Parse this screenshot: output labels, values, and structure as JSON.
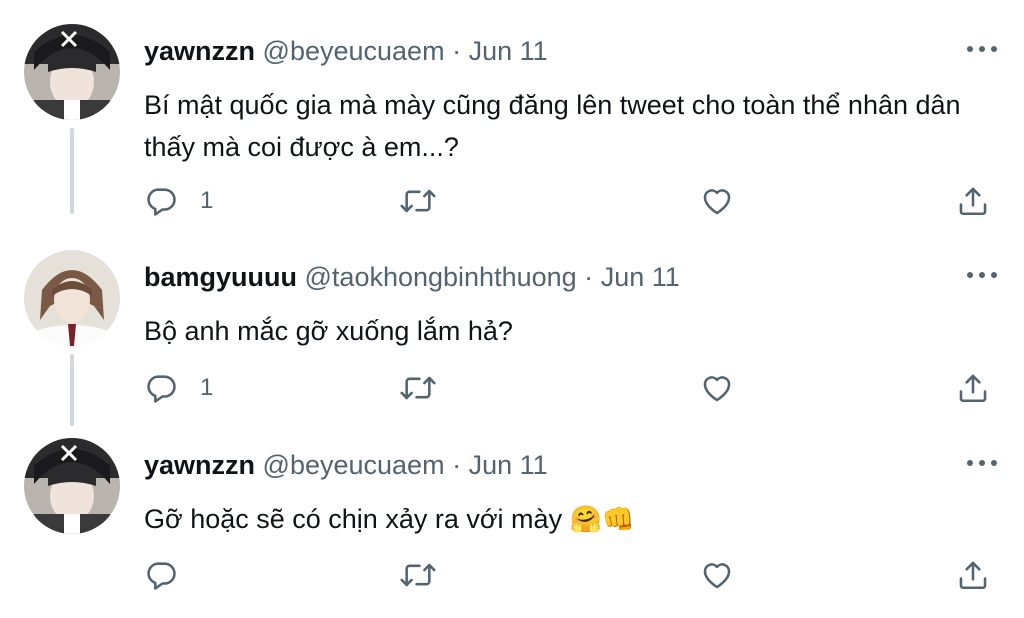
{
  "tweets": [
    {
      "name": "yawnzzn",
      "handle": "@beyeucuaem",
      "separator": "·",
      "date": "Jun 11",
      "text": "Bí mật quốc gia mà mày cũng đăng lên tweet cho toàn thể nhân dân thấy mà coi được à em...?",
      "emoji": "",
      "reply_count": "1"
    },
    {
      "name": "bamgyuuuu",
      "handle": "@taokhongbinhthuong",
      "separator": "·",
      "date": "Jun 11",
      "text": "Bộ anh mắc gỡ xuống lắm hả?",
      "emoji": "",
      "reply_count": "1"
    },
    {
      "name": "yawnzzn",
      "handle": "@beyeucuaem",
      "separator": "·",
      "date": "Jun 11",
      "text": "Gỡ hoặc sẽ có chịn xảy ra với mày ",
      "emoji": "🤗👊",
      "reply_count": ""
    }
  ],
  "icons": {
    "reply": "reply-icon",
    "retweet": "retweet-icon",
    "like": "heart-icon",
    "share": "share-icon",
    "more": "more-icon"
  },
  "colors": {
    "text": "#0f1419",
    "secondary": "#536471",
    "thread_line": "#cfd9de"
  }
}
